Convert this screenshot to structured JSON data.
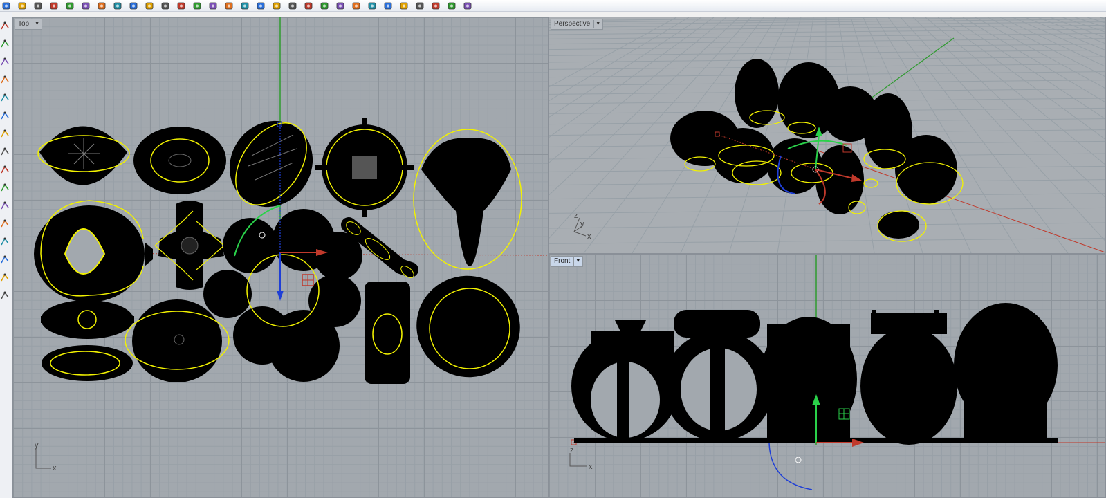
{
  "toolbar": {
    "icons": [
      "open-icon",
      "save-icon",
      "print-icon",
      "new-icon",
      "cut-icon",
      "copy-icon",
      "paste-icon",
      "undo-icon",
      "pan-icon",
      "rotate-view-icon",
      "zoom-icon",
      "zoom-window-icon",
      "zoom-extents-icon",
      "zoom-selected-icon",
      "zoom-target-icon",
      "grid-icon",
      "cplane-icon",
      "select-icon",
      "history-icon",
      "light-icon",
      "lock-icon",
      "layer-icon",
      "color-icon",
      "material-icon",
      "render-sphere-icon",
      "render-icon",
      "environment-icon",
      "snap-icon",
      "settings-icon",
      "help-icon"
    ]
  },
  "sidebar": {
    "tools": [
      "point-tool",
      "curve-tool",
      "polyline-tool",
      "rectangle-tool",
      "arc-tool",
      "circle-tool",
      "sphere-tool",
      "surface-tool",
      "solid-tool",
      "mesh-tool",
      "transform-tool",
      "edit-tool",
      "dimension-tool",
      "text-tool",
      "render-tool",
      "analysis-tool"
    ]
  },
  "viewports": {
    "top": {
      "label": "Top",
      "axis_x": "x",
      "axis_y": "y"
    },
    "perspective": {
      "label": "Perspective",
      "axis_x": "x",
      "axis_y": "y",
      "axis_z": "z"
    },
    "front": {
      "label": "Front",
      "axis_x": "x",
      "axis_z": "z"
    }
  },
  "colors": {
    "viewport_bg": "#a2a8ae",
    "object": "#000000",
    "selection": "#f2f200",
    "x_axis": "#c0392b",
    "y_axis": "#2e9b2e",
    "z_axis": "#1f3fd6"
  }
}
